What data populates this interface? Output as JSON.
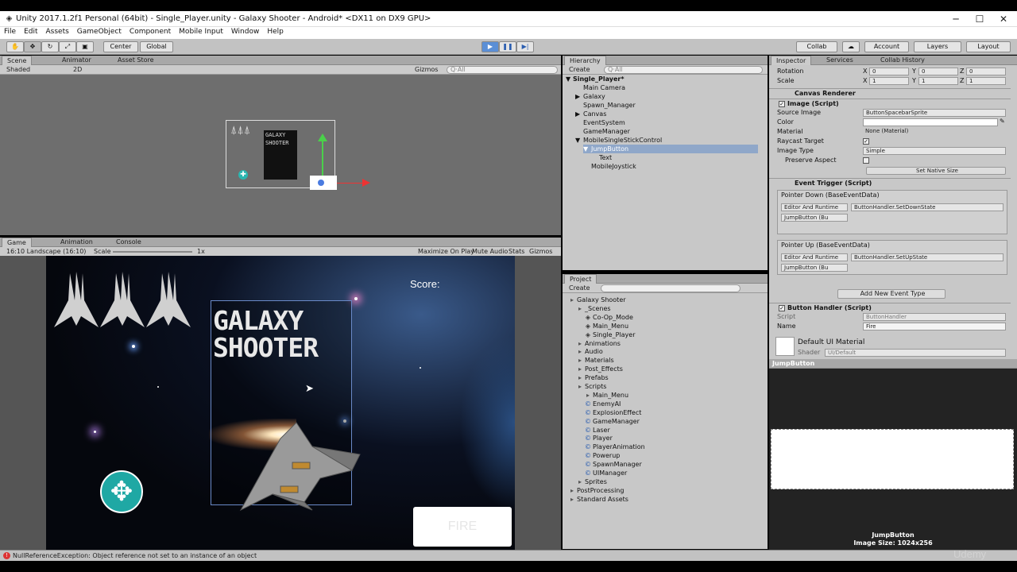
{
  "window": {
    "title": "Unity 2017.1.2f1 Personal (64bit) - Single_Player.unity - Galaxy Shooter - Android* <DX11 on DX9 GPU>"
  },
  "menu": [
    "File",
    "Edit",
    "Assets",
    "GameObject",
    "Component",
    "Mobile Input",
    "Window",
    "Help"
  ],
  "toolbar": {
    "center": "Center",
    "global": "Global",
    "collab": "Collab",
    "account": "Account",
    "layers": "Layers",
    "layout": "Layout"
  },
  "scene": {
    "tabs": [
      "Scene",
      "Animator",
      "Asset Store"
    ],
    "shading": "Shaded",
    "mode2d": "2D",
    "gizmos": "Gizmos",
    "search": "Q·All",
    "logo_line1": "GALAXY",
    "logo_line2": "SHOOTER"
  },
  "game": {
    "tabs": [
      "Game",
      "Animation",
      "Console"
    ],
    "aspect": "16:10 Landscape (16:10)",
    "scale_label": "Scale",
    "scale_value": "1x",
    "toggles": [
      "Maximize On Play",
      "Mute Audio",
      "Stats",
      "Gizmos"
    ],
    "score": "Score:",
    "logo_line1": "GALAXY",
    "logo_line2": "SHOOTER",
    "fire": "FIRE"
  },
  "hierarchy": {
    "title": "Hierarchy",
    "create": "Create",
    "search": "Q·All",
    "scene": "Single_Player*",
    "items": [
      {
        "label": "Main Camera",
        "indent": 1,
        "arrow": ""
      },
      {
        "label": "Galaxy",
        "indent": 1,
        "arrow": "▶"
      },
      {
        "label": "Spawn_Manager",
        "indent": 1,
        "arrow": ""
      },
      {
        "label": "Canvas",
        "indent": 1,
        "arrow": "▶"
      },
      {
        "label": "EventSystem",
        "indent": 1,
        "arrow": ""
      },
      {
        "label": "GameManager",
        "indent": 1,
        "arrow": ""
      },
      {
        "label": "MobileSingleStickControl",
        "indent": 1,
        "arrow": "▼"
      },
      {
        "label": "JumpButton",
        "indent": 2,
        "arrow": "▼"
      },
      {
        "label": "Text",
        "indent": 3,
        "arrow": ""
      },
      {
        "label": "MobileJoystick",
        "indent": 2,
        "arrow": ""
      }
    ]
  },
  "project": {
    "title": "Project",
    "create": "Create",
    "items": [
      {
        "label": "Galaxy Shooter",
        "indent": 0,
        "type": "folder"
      },
      {
        "label": "_Scenes",
        "indent": 1,
        "type": "folder"
      },
      {
        "label": "Co-Op_Mode",
        "indent": 2,
        "type": "scene"
      },
      {
        "label": "Main_Menu",
        "indent": 2,
        "type": "scene"
      },
      {
        "label": "Single_Player",
        "indent": 2,
        "type": "scene"
      },
      {
        "label": "Animations",
        "indent": 1,
        "type": "folder"
      },
      {
        "label": "Audio",
        "indent": 1,
        "type": "folder"
      },
      {
        "label": "Materials",
        "indent": 1,
        "type": "folder"
      },
      {
        "label": "Post_Effects",
        "indent": 1,
        "type": "folder"
      },
      {
        "label": "Prefabs",
        "indent": 1,
        "type": "folder"
      },
      {
        "label": "Scripts",
        "indent": 1,
        "type": "folder"
      },
      {
        "label": "Main_Menu",
        "indent": 2,
        "type": "folder"
      },
      {
        "label": "EnemyAI",
        "indent": 2,
        "type": "script"
      },
      {
        "label": "ExplosionEffect",
        "indent": 2,
        "type": "script"
      },
      {
        "label": "GameManager",
        "indent": 2,
        "type": "script"
      },
      {
        "label": "Laser",
        "indent": 2,
        "type": "script"
      },
      {
        "label": "Player",
        "indent": 2,
        "type": "script"
      },
      {
        "label": "PlayerAnimation",
        "indent": 2,
        "type": "script"
      },
      {
        "label": "Powerup",
        "indent": 2,
        "type": "script"
      },
      {
        "label": "SpawnManager",
        "indent": 2,
        "type": "script"
      },
      {
        "label": "UIManager",
        "indent": 2,
        "type": "script"
      },
      {
        "label": "Sprites",
        "indent": 1,
        "type": "folder"
      },
      {
        "label": "PostProcessing",
        "indent": 0,
        "type": "folder"
      },
      {
        "label": "Standard Assets",
        "indent": 0,
        "type": "folder"
      }
    ]
  },
  "inspector": {
    "tabs": [
      "Inspector",
      "Services",
      "Collab History"
    ],
    "rotation": {
      "label": "Rotation",
      "x": "0",
      "y": "0",
      "z": "0"
    },
    "scale": {
      "label": "Scale",
      "x": "1",
      "y": "1",
      "z": "1"
    },
    "canvas_renderer": "Canvas Renderer",
    "image_script": "Image (Script)",
    "source_image": {
      "label": "Source Image",
      "value": "ButtonSpacebarSprite"
    },
    "color_label": "Color",
    "material": {
      "label": "Material",
      "value": "None (Material)"
    },
    "raycast": "Raycast Target",
    "image_type": {
      "label": "Image Type",
      "value": "Simple"
    },
    "preserve": "Preserve Aspect",
    "set_native": "Set Native Size",
    "event_trigger": "Event Trigger (Script)",
    "pointer_down": {
      "title": "Pointer Down (BaseEventData)",
      "mode": "Editor And Runtime",
      "func": "ButtonHandler.SetDownState",
      "obj": "JumpButton (Bu"
    },
    "pointer_up": {
      "title": "Pointer Up (BaseEventData)",
      "mode": "Editor And Runtime",
      "func": "ButtonHandler.SetUpState",
      "obj": "JumpButton (Bu"
    },
    "add_event": "Add New Event Type",
    "button_handler": "Button Handler (Script)",
    "script": {
      "label": "Script",
      "value": "ButtonHandler"
    },
    "name": {
      "label": "Name",
      "value": "Fire"
    },
    "material_name": "Default UI Material",
    "shader": {
      "label": "Shader",
      "value": "UI/Default"
    },
    "preview_title": "JumpButton",
    "preview_name": "JumpButton",
    "preview_size": "Image Size: 1024x256"
  },
  "status": "NullReferenceException: Object reference not set to an instance of an object",
  "watermark": "Udemy"
}
